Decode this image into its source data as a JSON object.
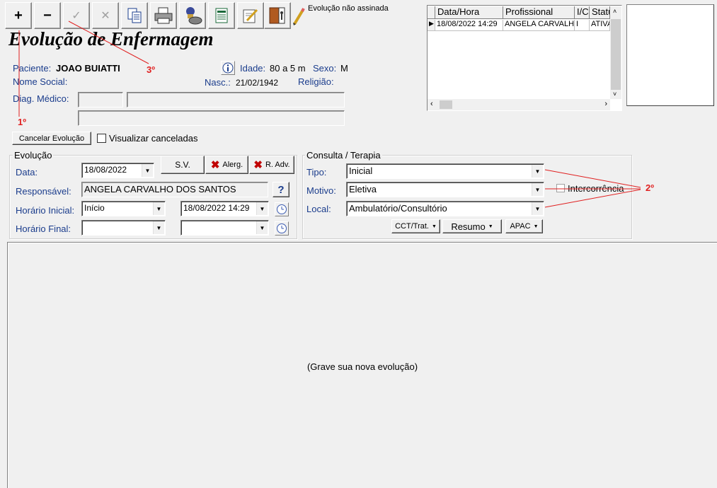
{
  "toolbar": {
    "add_label": "+",
    "remove_label": "−",
    "confirm_label": "✓",
    "cancel_label": "✕",
    "status_text": "Evolução não assinada"
  },
  "header": {
    "title": "Evolução de Enfermagem"
  },
  "patient": {
    "paciente_label": "Paciente:",
    "paciente_value": "JOAO BUIATTI",
    "idade_label": "Idade:",
    "idade_value": "80 a 5 m",
    "sexo_label": "Sexo:",
    "sexo_value": "M",
    "nome_social_label": "Nome Social:",
    "nasc_label": "Nasc.:",
    "nasc_value": "21/02/1942",
    "religiao_label": "Religião:",
    "diag_label": "Diag. Médico:"
  },
  "actions": {
    "cancelar_label": "Cancelar Evolução",
    "visualizar_label": "Visualizar canceladas"
  },
  "evolucao": {
    "group_title": "Evolução",
    "data_label": "Data:",
    "data_value": "18/08/2022",
    "sv_label": "S.V.",
    "alerg_label": "Alerg.",
    "radv_label": "R. Adv.",
    "responsavel_label": "Responsável:",
    "responsavel_value": "ANGELA CARVALHO DOS SANTOS",
    "help_label": "?",
    "horario_inicial_label": "Horário Inicial:",
    "horario_inicial_value": "Início",
    "horario_inicial_datetime": "18/08/2022 14:29",
    "horario_final_label": "Horário Final:",
    "horario_final_value": "",
    "horario_final_datetime": ""
  },
  "consulta": {
    "group_title": "Consulta / Terapia",
    "tipo_label": "Tipo:",
    "tipo_value": "Inicial",
    "motivo_label": "Motivo:",
    "motivo_value": "Eletiva",
    "intercorrencia_label": "Intercorrência",
    "local_label": "Local:",
    "local_value": "Ambulatório/Consultório",
    "cct_label": "CCT/Trat.",
    "resumo_label": "Resumo",
    "apac_label": "APAC"
  },
  "grid": {
    "headers": [
      "Data/Hora",
      "Profissional",
      "I/C",
      "Status"
    ],
    "rows": [
      [
        "18/08/2022 14:29",
        "ANGELA CARVALHO",
        "I",
        "ATIVA"
      ]
    ]
  },
  "main": {
    "placeholder": "(Grave sua nova evolução)"
  },
  "annotations": {
    "first": "1º",
    "second": "2º",
    "third": "3º"
  },
  "colors": {
    "label_blue": "#1a3c8c",
    "annotation_red": "#e02020",
    "window_bg": "#f0f0f0"
  }
}
